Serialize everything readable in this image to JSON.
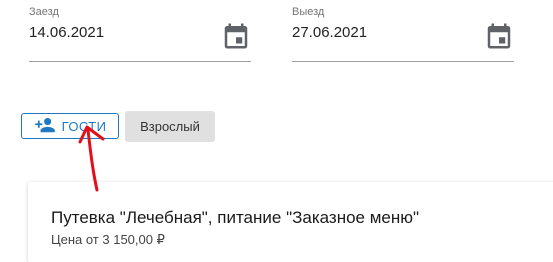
{
  "dates": {
    "checkin": {
      "label": "Заезд",
      "value": "14.06.2021",
      "icon": "calendar-icon"
    },
    "checkout": {
      "label": "Выезд",
      "value": "27.06.2021",
      "icon": "calendar-icon"
    }
  },
  "guests": {
    "button_label": "ГОСТИ",
    "icon": "person-add-icon",
    "chip_label": "Взрослый"
  },
  "offer": {
    "title": "Путевка \"Лечебная\", питание \"Заказное меню\"",
    "price": "Цена от 3 150,00 ₽"
  },
  "colors": {
    "accent": "#1e78c2",
    "annotation_arrow": "#e3101b",
    "chip_bg": "#e0e0e0"
  }
}
